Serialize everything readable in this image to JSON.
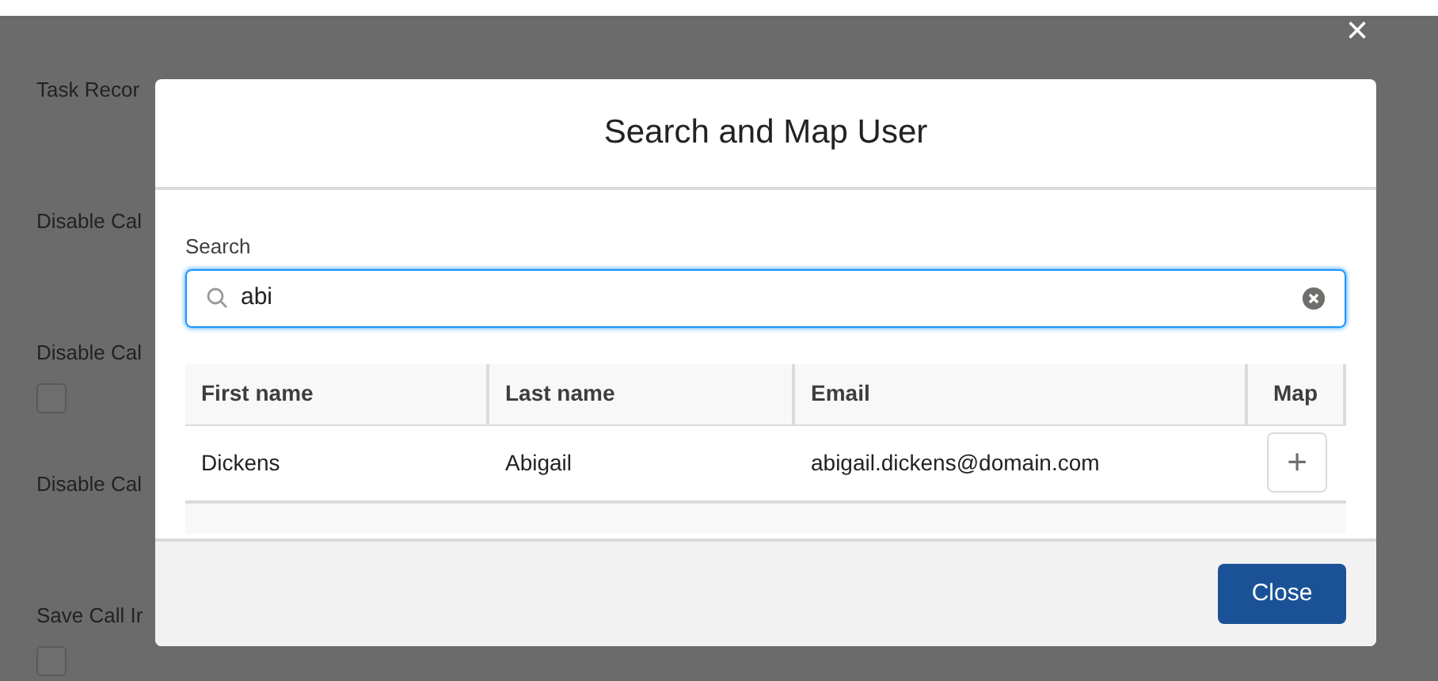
{
  "background_settings": [
    {
      "label": "Task Recor"
    },
    {
      "label": "Disable Cal"
    },
    {
      "label": "Disable Cal",
      "checkbox": {
        "checked": false
      }
    },
    {
      "label": "Disable Cal"
    },
    {
      "label": "Save Call Ir",
      "checkbox": {
        "checked": false
      }
    }
  ],
  "modal": {
    "title": "Search and Map User",
    "search": {
      "label": "Search",
      "value": "abi"
    },
    "table": {
      "columns": [
        "First name",
        "Last name",
        "Email",
        "Map"
      ],
      "rows": [
        {
          "first_name": "Dickens",
          "last_name": "Abigail",
          "email": "abigail.dickens@domain.com",
          "map_button": "+"
        }
      ]
    },
    "buttons": [
      "Close"
    ]
  },
  "close_icon": "×"
}
